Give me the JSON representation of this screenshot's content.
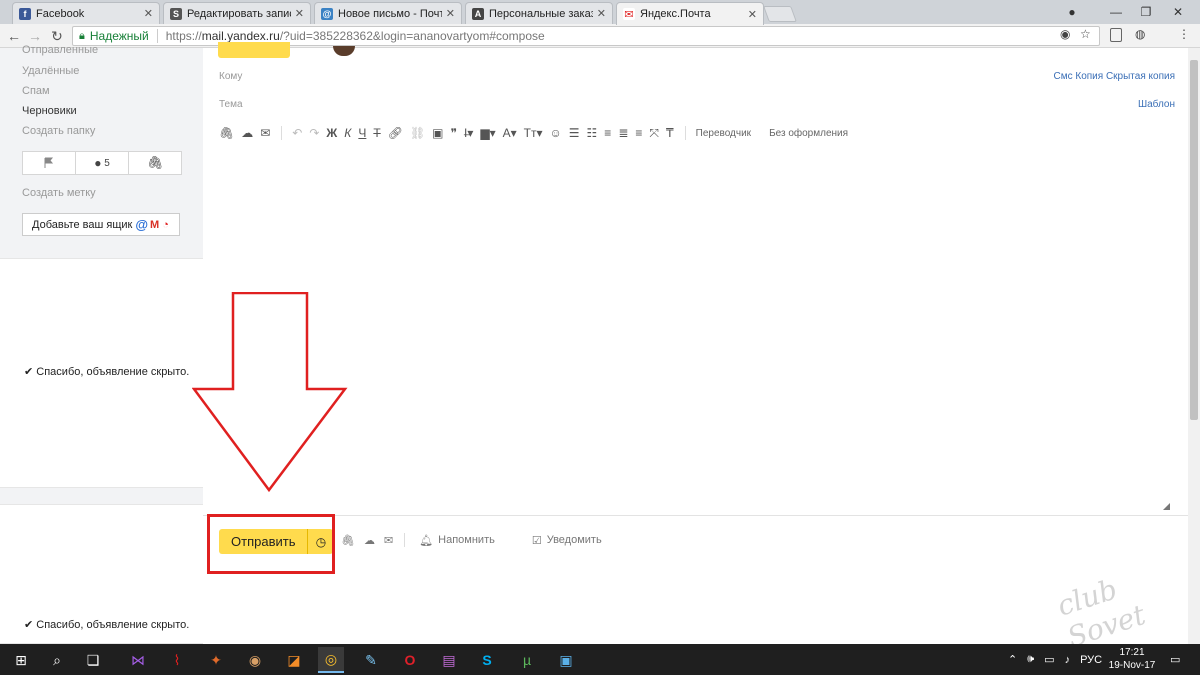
{
  "browser": {
    "tabs": [
      {
        "label": "Facebook",
        "icon": "facebook-icon",
        "color": "#3b5998",
        "glyph": "f",
        "active": false
      },
      {
        "label": "Редактировать запись",
        "icon": "site-s-icon",
        "color": "#555555",
        "glyph": "S",
        "active": false
      },
      {
        "label": "Новое письмо - Почта",
        "icon": "mail-at-icon",
        "color": "#3b82c4",
        "glyph": "@",
        "active": false
      },
      {
        "label": "Персональные заказы",
        "icon": "letter-a-icon",
        "color": "#444444",
        "glyph": "A",
        "active": false
      },
      {
        "label": "Яндекс.Почта",
        "icon": "yandex-mail-icon",
        "color": "#e02020",
        "glyph": "✉",
        "active": true
      }
    ],
    "address": {
      "secure_label": "Надежный",
      "url_prefix": "https://",
      "url_host": "mail.yandex.ru",
      "url_rest": "/?uid=385228362&login=ananovartyom#compose"
    }
  },
  "sidebar": {
    "folders": [
      "Отправленные",
      "Удалённые",
      "Спам",
      "Черновики",
      "Создать папку"
    ],
    "current_folder": "Черновики",
    "toolbar": {
      "count": "5"
    },
    "create_label": "Создать метку",
    "add_box_label": "Добавьте ваш ящик",
    "ad_hidden_1": "Спасибо, объявление скрыто.",
    "ad_hidden_2": "Спасибо, объявление скрыто."
  },
  "compose": {
    "to_label": "Кому",
    "to_options": "Смс Копия Скрытая копия",
    "subject_label": "Тема",
    "template_label": "Шаблон",
    "format": {
      "bold": "Ж",
      "italic": "К",
      "underline": "Ч",
      "strike": "Т",
      "translator": "Переводчик",
      "no_format": "Без оформления"
    },
    "send_label": "Отправить",
    "remind_label": "Напомнить",
    "notify_label": "Уведомить"
  },
  "taskbar": {
    "lang": "РУС",
    "time": "17:21",
    "date": "19-Nov-17"
  },
  "watermark": "club Sovet",
  "colors": {
    "accent_yellow": "#ffdb4d",
    "annotation_red": "#e02020",
    "link_blue": "#3b6fb6",
    "secure_green": "#188038"
  }
}
